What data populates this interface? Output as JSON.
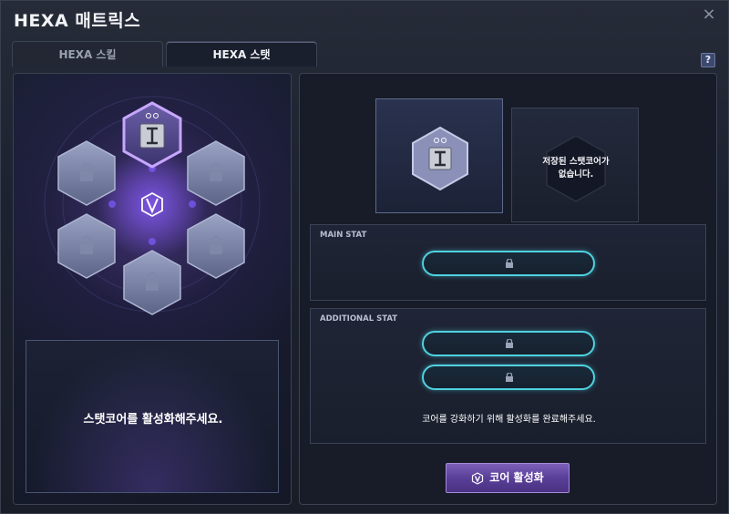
{
  "window": {
    "title": "HEXA 매트릭스",
    "close_label": "×",
    "help_label": "?"
  },
  "tabs": [
    {
      "label": "HEXA 스킬",
      "active": false
    },
    {
      "label": "HEXA 스탯",
      "active": true
    }
  ],
  "left": {
    "cores": [
      {
        "position": "top",
        "state": "selected",
        "icon": "stat-core-icon"
      },
      {
        "position": "upper-left",
        "state": "locked",
        "icon": "lock-icon"
      },
      {
        "position": "upper-right",
        "state": "locked",
        "icon": "lock-icon"
      },
      {
        "position": "lower-left",
        "state": "locked",
        "icon": "lock-icon"
      },
      {
        "position": "lower-right",
        "state": "locked",
        "icon": "lock-icon"
      },
      {
        "position": "bottom",
        "state": "locked",
        "icon": "lock-icon"
      }
    ],
    "center_icon": "hexa-v-emblem-icon",
    "message": "스탯코어를 활성화해주세요."
  },
  "right": {
    "saved_core_text_line1": "저장된 스탯코어가",
    "saved_core_text_line2": "없습니다.",
    "main_stat_label": "MAIN STAT",
    "additional_stat_label": "ADDITIONAL STAT",
    "hint": "코어를 강화하기 위해 활성화를 완료해주세요.",
    "activate_button": "코어 활성화"
  },
  "colors": {
    "accent_purple": "#7b5fb8",
    "slot_cyan": "#4fd2e0",
    "selected_glow": "#b592ff"
  }
}
